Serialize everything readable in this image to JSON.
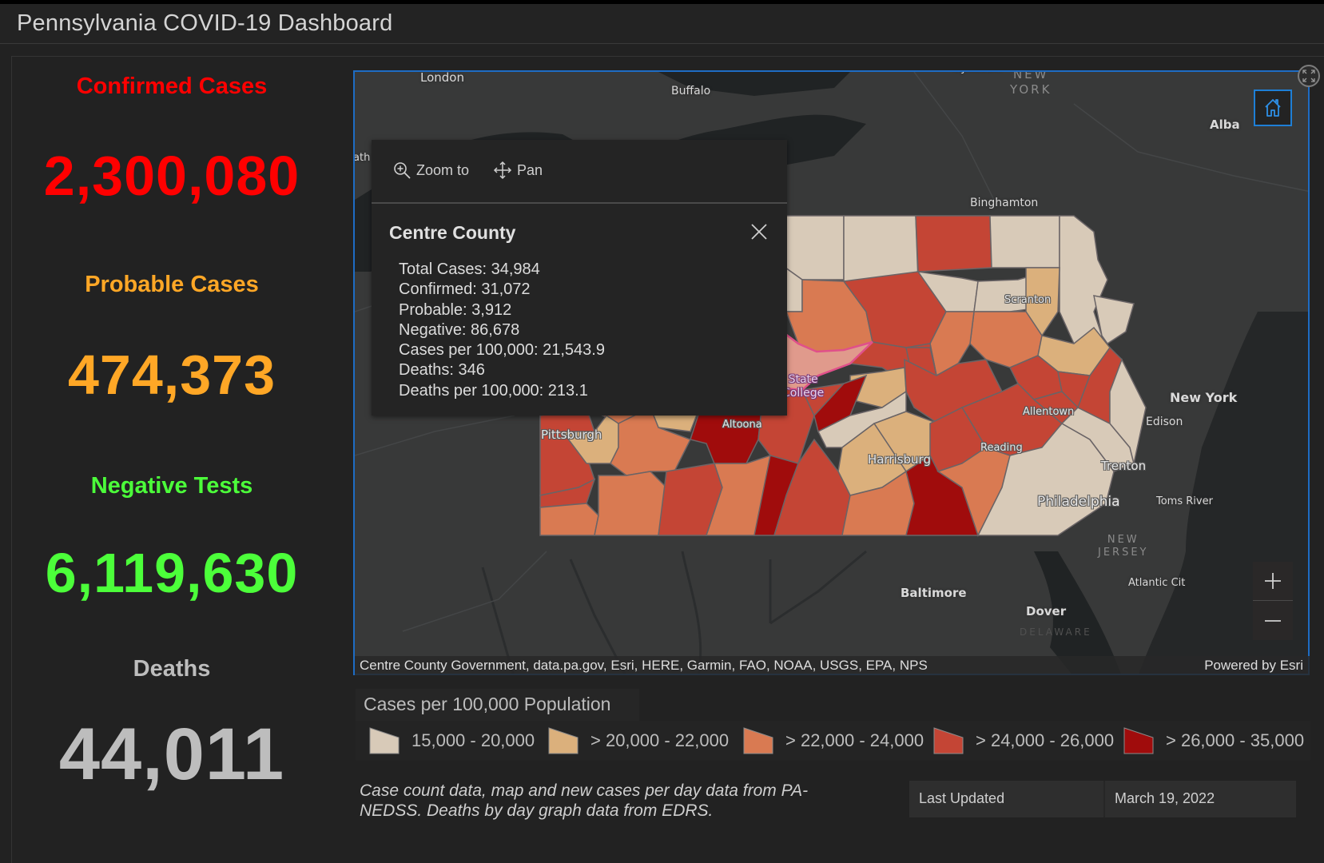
{
  "header": {
    "title": "Pennsylvania COVID-19 Dashboard"
  },
  "stats": [
    {
      "label": "Confirmed Cases",
      "value": "2,300,080",
      "color": "#ff0000"
    },
    {
      "label": "Probable Cases",
      "value": "474,373",
      "color": "#ffa726"
    },
    {
      "label": "Negative Tests",
      "value": "6,119,630",
      "color": "#4cff3a"
    },
    {
      "label": "Deaths",
      "value": "44,011",
      "color": "#bdbdbd"
    }
  ],
  "map": {
    "labels": {
      "london": "London",
      "buffalo": "Buffalo",
      "syracuse": "Syracuse",
      "new_york_state": "NEW\nYORK",
      "albany": "Alba",
      "binghamton": "Binghamton",
      "scranton": "Scranton",
      "new_york_city": "New York",
      "edison": "Edison",
      "allentown": "Allentown",
      "reading": "Reading",
      "trenton": "Trenton",
      "philadelphia": "Philadelphia",
      "toms_river": "Toms River",
      "new_jersey": "NEW\nJERSEY",
      "atlantic_city": "Atlantic Cit",
      "baltimore": "Baltimore",
      "dover": "Dover",
      "delaware": "DELAWARE",
      "pittsburgh": "Pittsburgh",
      "altoona": "Altoona",
      "harrisburg": "Harrisburg",
      "state_college": "State\nCollege",
      "partial_left": "ath"
    },
    "attribution": "Centre County Government, data.pa.gov, Esri, HERE, Garmin, FAO, NOAA, USGS, EPA, NPS",
    "powered_by": "Powered by Esri",
    "selected_county": "Centre County"
  },
  "popup": {
    "actions": {
      "zoom_to": "Zoom to",
      "pan": "Pan"
    },
    "title": "Centre County",
    "fields": [
      "Total Cases: 34,984",
      "Confirmed: 31,072",
      "Probable: 3,912",
      "Negative: 86,678",
      "Cases per 100,000: 21,543.9",
      "Deaths: 346",
      "Deaths per 100,000: 213.1"
    ]
  },
  "legend": {
    "title": "Cases per 100,000 Population",
    "classes": [
      {
        "label": "15,000 - 20,000",
        "color": "#d8cab8"
      },
      {
        "label": "> 20,000 - 22,000",
        "color": "#dbb07c"
      },
      {
        "label": "> 22,000 - 24,000",
        "color": "#d97a52"
      },
      {
        "label": "> 24,000 - 26,000",
        "color": "#c44535"
      },
      {
        "label": "> 26,000 - 35,000",
        "color": "#a00c0c"
      }
    ],
    "highlight_color": "#e09a8c"
  },
  "footnote": "Case count data, map and new cases per day data from PA-NEDSS.  Deaths by day graph data from EDRS.",
  "last_updated": {
    "label": "Last Updated",
    "value": "March 19, 2022"
  }
}
